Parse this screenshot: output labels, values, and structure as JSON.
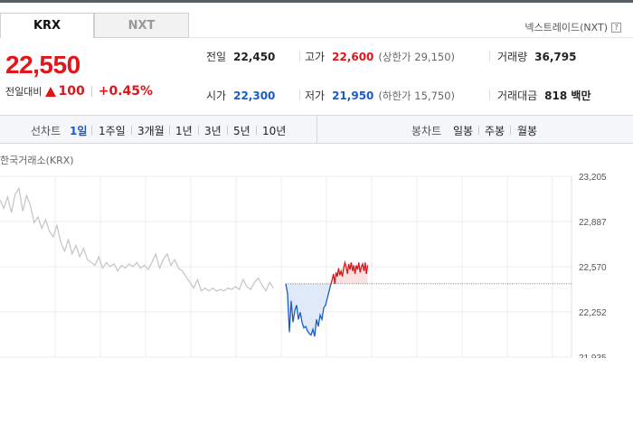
{
  "tabs": {
    "krx": "KRX",
    "nxt": "NXT"
  },
  "nxt_link": {
    "label": "넥스트레이드(NXT)",
    "icon": "?"
  },
  "price": {
    "current": "22,550",
    "change_label": "전일대비",
    "change_amount": "100",
    "change_pct": "+0.45%",
    "color_up": "#e0161b",
    "color_down": "#1a5cc8"
  },
  "stats": {
    "prev_close": {
      "label": "전일",
      "value": "22,450"
    },
    "high": {
      "label": "고가",
      "value": "22,600",
      "limit": "(상한가 29,150)"
    },
    "volume": {
      "label": "거래량",
      "value": "36,795"
    },
    "open": {
      "label": "시가",
      "value": "22,300"
    },
    "low": {
      "label": "저가",
      "value": "21,950",
      "limit": "(하한가 15,750)"
    },
    "amount": {
      "label": "거래대금",
      "value": "818 백만"
    }
  },
  "period_bar": {
    "line_label": "선차트",
    "line_periods": [
      "1일",
      "1주일",
      "3개월",
      "1년",
      "3년",
      "5년",
      "10년"
    ],
    "active_period": "1일",
    "candle_label": "봉차트",
    "candle_periods": [
      "일봉",
      "주봉",
      "월봉"
    ]
  },
  "chart_data": {
    "type": "line",
    "title": "",
    "exchange_label": "한국거래소(KRX)",
    "y_ticks": [
      "23,205",
      "22,887",
      "22,570",
      "22,252",
      "21,935"
    ],
    "ylim": [
      21935,
      23205
    ],
    "reference_price": 22450,
    "grid": true,
    "series": [
      {
        "segment": "previous-session",
        "color": "#c4c4c4",
        "values": [
          23040,
          22980,
          23060,
          22950,
          23080,
          23120,
          22960,
          23070,
          23000,
          22880,
          22920,
          22840,
          22900,
          22820,
          22780,
          22860,
          22740,
          22680,
          22760,
          22660,
          22720,
          22640,
          22700,
          22620,
          22600,
          22580,
          22640,
          22560,
          22600,
          22570,
          22590,
          22540,
          22580,
          22560,
          22590,
          22570,
          22600,
          22560,
          22580,
          22550,
          22600,
          22660,
          22560,
          22620,
          22660,
          22580,
          22620,
          22560,
          22540,
          22500,
          22460,
          22420,
          22480,
          22400,
          22420,
          22400,
          22420,
          22400,
          22410,
          22400,
          22420,
          22410,
          22430,
          22410,
          22480,
          22430,
          22410,
          22460,
          22490,
          22440,
          22400,
          22460,
          22420
        ]
      },
      {
        "segment": "today-below-reference",
        "color": "#1a5cc8",
        "values": [
          22450,
          22380,
          22110,
          22330,
          22180,
          22260,
          22300,
          22200,
          22250,
          22180,
          22140,
          22150,
          22120,
          22100,
          22090,
          22130,
          22080,
          22200,
          22150,
          22230,
          22200,
          22280,
          22300,
          22350,
          22400,
          22450
        ]
      },
      {
        "segment": "today-above-reference",
        "color": "#e0161b",
        "values": [
          22450,
          22480,
          22520,
          22450,
          22530,
          22500,
          22560,
          22510,
          22540,
          22500,
          22560,
          22600,
          22570,
          22520,
          22590,
          22550,
          22600,
          22540,
          22580,
          22520,
          22580,
          22550,
          22600,
          22530,
          22570,
          22590,
          22540,
          22600,
          22520,
          22580
        ]
      }
    ]
  }
}
